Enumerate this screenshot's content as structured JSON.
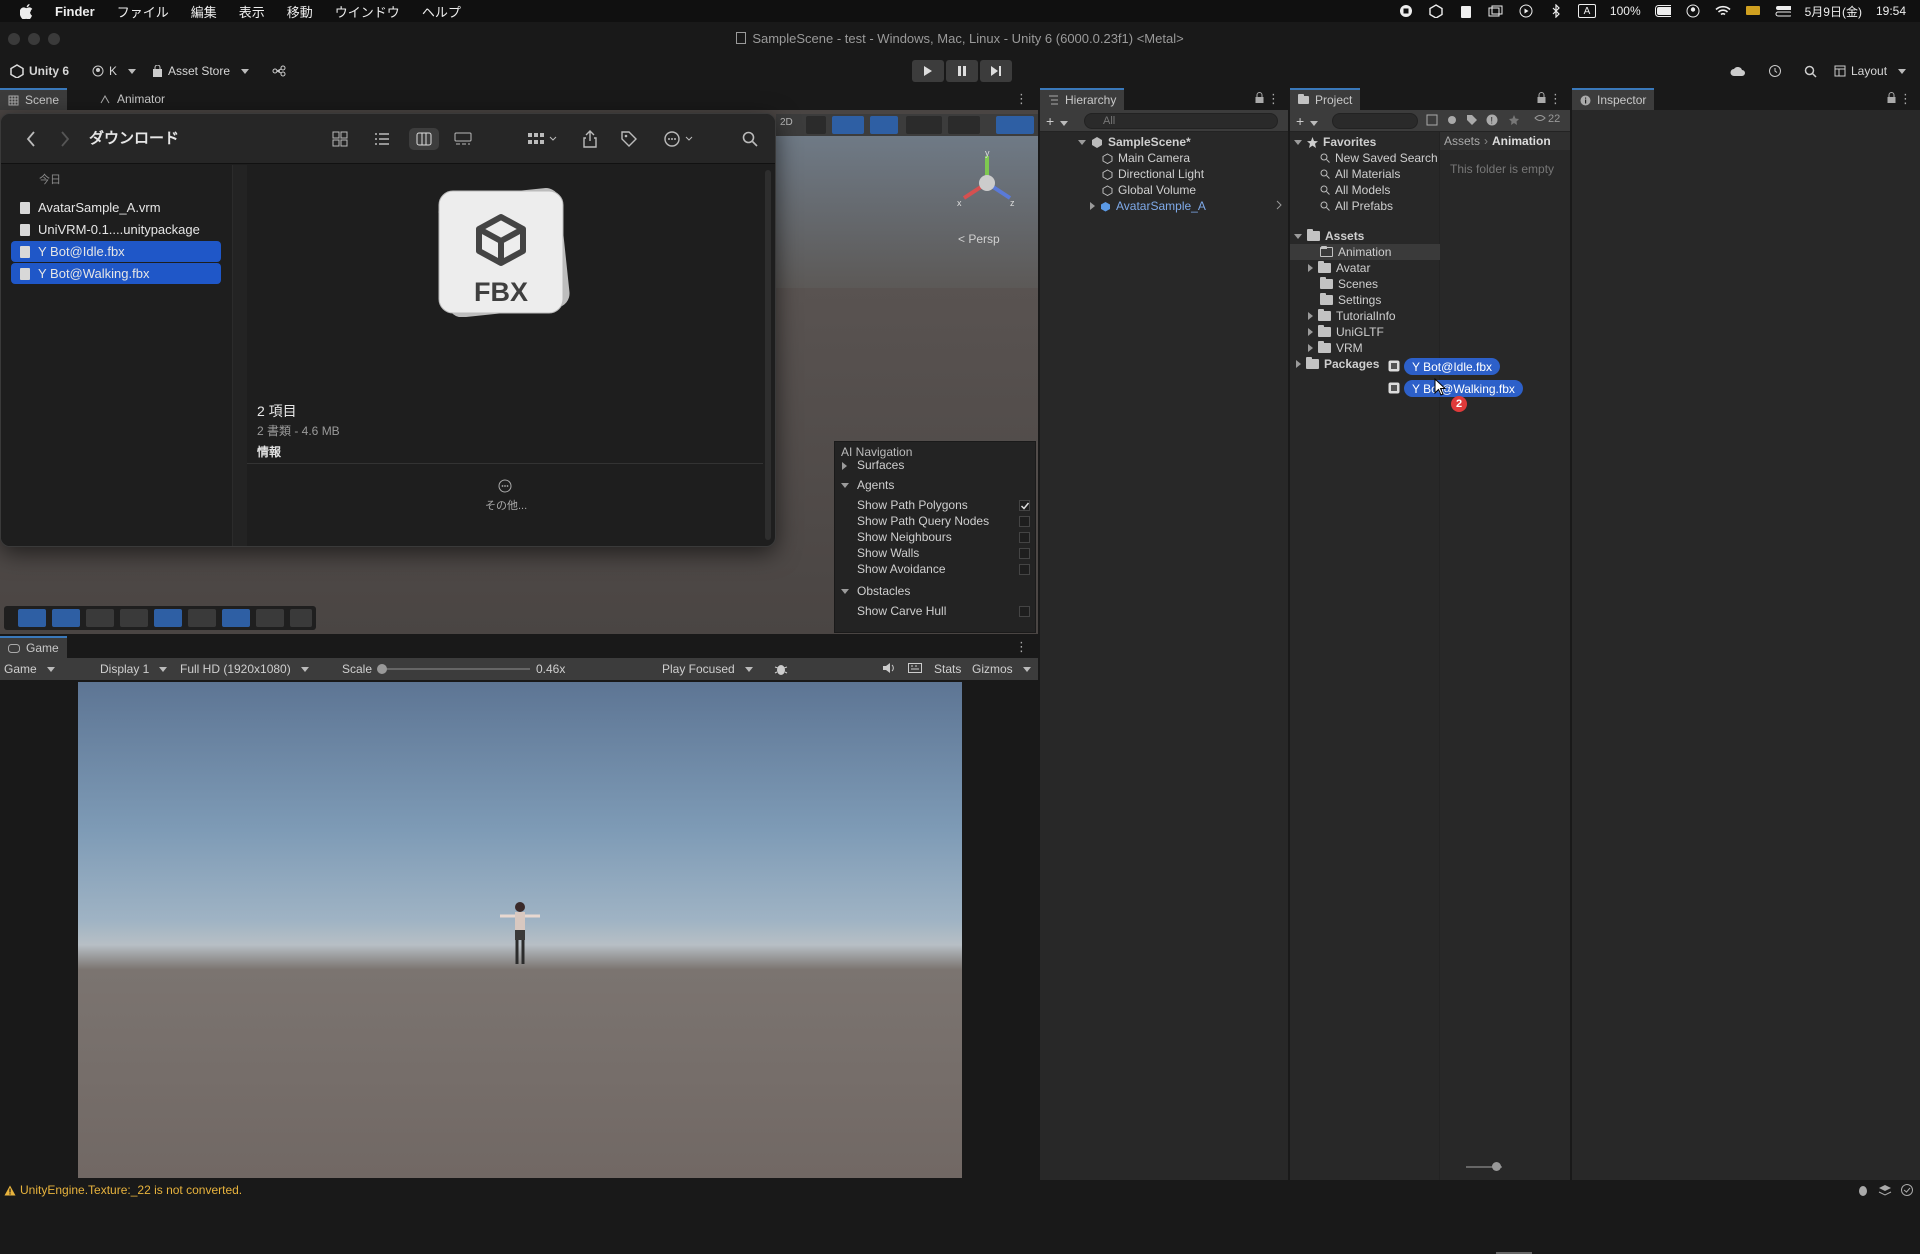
{
  "menubar": {
    "app": "Finder",
    "items": [
      "ファイル",
      "編集",
      "表示",
      "移動",
      "ウインドウ",
      "ヘルプ"
    ],
    "battery": "100%",
    "date": "5月9日(金)",
    "time": "19:54",
    "input": "A"
  },
  "title": "SampleScene - test - Windows, Mac, Linux - Unity 6 (6000.0.23f1) <Metal>",
  "toolbar": {
    "unity": "Unity 6",
    "account": "K",
    "asset_store": "Asset Store",
    "layout": "Layout"
  },
  "scene_tabs": {
    "scene": "Scene",
    "animator": "Animator"
  },
  "scene": {
    "persp": "< Persp"
  },
  "finder": {
    "title": "ダウンロード",
    "today": "今日",
    "files": [
      "AvatarSample_A.vrm",
      "UniVRM-0.1....unitypackage",
      "Y Bot@Idle.fbx",
      "Y Bot@Walking.fbx"
    ],
    "preview_label": "FBX",
    "count": "2 項目",
    "kinds": "2 書類 - 4.6 MB",
    "info": "情報",
    "more": "その他..."
  },
  "nav": {
    "title": "AI Navigation",
    "surfaces": "Surfaces",
    "agents": "Agents",
    "agent_rows": [
      "Show Path Polygons",
      "Show Path Query Nodes",
      "Show Neighbours",
      "Show Walls",
      "Show Avoidance"
    ],
    "obstacles": "Obstacles",
    "obstacle_rows": [
      "Show Carve Hull"
    ]
  },
  "game": {
    "tab": "Game",
    "mode": "Game",
    "display": "Display 1",
    "resolution": "Full HD (1920x1080)",
    "scale_label": "Scale",
    "scale_value": "0.46x",
    "play_focused": "Play Focused",
    "stats": "Stats",
    "gizmos": "Gizmos"
  },
  "hierarchy": {
    "tab": "Hierarchy",
    "search": "All",
    "scene": "SampleScene*",
    "items": [
      "Main Camera",
      "Directional Light",
      "Global Volume",
      "AvatarSample_A"
    ]
  },
  "project": {
    "tab": "Project",
    "count": "22",
    "favorites": "Favorites",
    "fav_items": [
      "New Saved Search",
      "All Materials",
      "All Models",
      "All Prefabs"
    ],
    "assets": "Assets",
    "asset_items": [
      "Animation",
      "Avatar",
      "Scenes",
      "Settings",
      "TutorialInfo",
      "UniGLTF",
      "VRM"
    ],
    "packages": "Packages",
    "breadcrumb_root": "Assets",
    "breadcrumb_current": "Animation",
    "empty": "This folder is empty",
    "drag_items": [
      "Y Bot@Idle.fbx",
      "Y Bot@Walking.fbx"
    ],
    "drag_count": "2"
  },
  "inspector": {
    "tab": "Inspector"
  },
  "status": {
    "message": "UnityEngine.Texture:_22 is not converted."
  }
}
